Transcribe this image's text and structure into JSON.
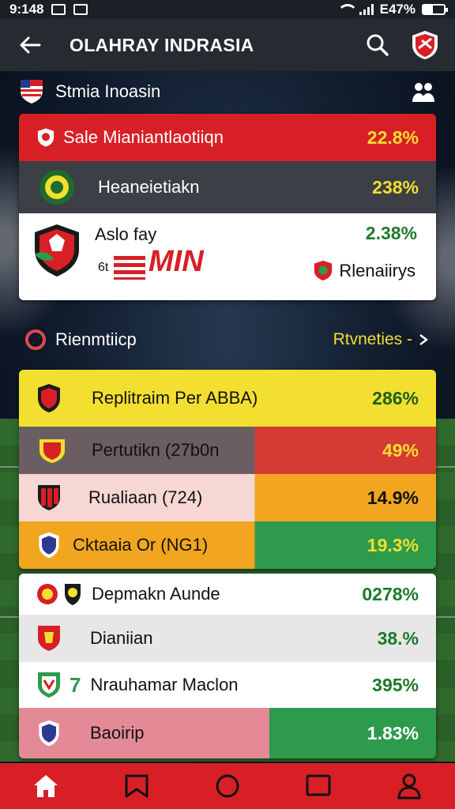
{
  "status_bar": {
    "time": "9:148",
    "battery_text": "E47%"
  },
  "app_bar": {
    "title": "OLAHRAY INDRASIA"
  },
  "sub_header": {
    "title": "Stmia Inoasin"
  },
  "top_card": {
    "header": {
      "label": "Sale Mianiantlaotiiqn",
      "value": "22.8%"
    },
    "row1": {
      "label": "Heaneietiakn",
      "value": "238%"
    },
    "row2": {
      "label": "Aslo fay",
      "value": "2.38%",
      "small_left": "6t",
      "stamp_text": "MIN",
      "right_label": "Rlenaiirys"
    }
  },
  "section": {
    "label": "Rienmtiicp",
    "action": "Rtvneties -"
  },
  "mid_card": {
    "rows": [
      {
        "label": "Replitraim Per ABBA)",
        "value": "286%"
      },
      {
        "label": "Pertutikn (27b0n",
        "value": "49%"
      },
      {
        "label": "Rualiaan (724)",
        "value": "14.9%"
      },
      {
        "label": "Cktaaia Or (NG1)",
        "value": "19.3%"
      }
    ]
  },
  "bottom_card": {
    "rows": [
      {
        "label": "Depmakn Aunde",
        "value": "0278%"
      },
      {
        "label": "Dianiian",
        "value": "38.%"
      },
      {
        "label": "Nrauhamar Maclon",
        "value": "395%",
        "prefix": "7"
      },
      {
        "label": "Baoirip",
        "value": "1.83%"
      }
    ]
  },
  "colors": {
    "accent_red": "#d81f26",
    "yellow": "#f3df2f",
    "green": "#2d9b4b",
    "orange": "#f2a51f",
    "pink": "#f6d7d3",
    "dark_row": "#3c3f45"
  },
  "icons": [
    "back-arrow-icon",
    "search-icon",
    "club-crest-icon",
    "flag-shield-icon",
    "people-icon",
    "ring-icon",
    "chevron-right-icon",
    "home-icon",
    "bookmark-icon",
    "circle-icon",
    "square-icon",
    "profile-icon"
  ]
}
